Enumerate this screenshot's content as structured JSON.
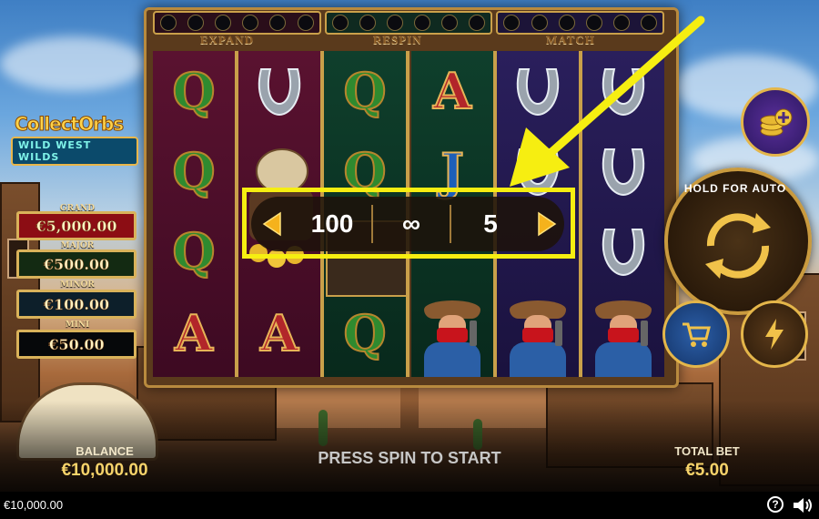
{
  "features": {
    "expand": "EXPAND",
    "respin": "RESPIN",
    "match": "MATCH"
  },
  "logo": {
    "line1": "CollectOrbs",
    "line2": "WILD WEST WILDS"
  },
  "jackpots": [
    {
      "label": "GRAND",
      "value": "€5,000.00"
    },
    {
      "label": "MAJOR",
      "value": "€500.00"
    },
    {
      "label": "MINOR",
      "value": "€100.00"
    },
    {
      "label": "MINI",
      "value": "€50.00"
    }
  ],
  "reels": {
    "col1": [
      "Q",
      "Q",
      "Q",
      "A"
    ],
    "col3": [
      "Q",
      "Q",
      "Q"
    ],
    "col4": [
      "A",
      "J"
    ],
    "col6": []
  },
  "autoplay": {
    "hold_label": "HOLD FOR AUTO",
    "spins": "100",
    "loss_limit": "∞",
    "win_limit": "5"
  },
  "bottom": {
    "balance_label": "BALANCE",
    "balance_value": "€10,000.00",
    "prompt": "PRESS SPIN TO START",
    "bet_label": "TOTAL BET",
    "bet_value": "€5.00"
  },
  "status": {
    "balance": "€10,000.00",
    "help": "?"
  },
  "colors": {
    "highlight": "#f6ee11",
    "gold": "#e4b64a"
  }
}
